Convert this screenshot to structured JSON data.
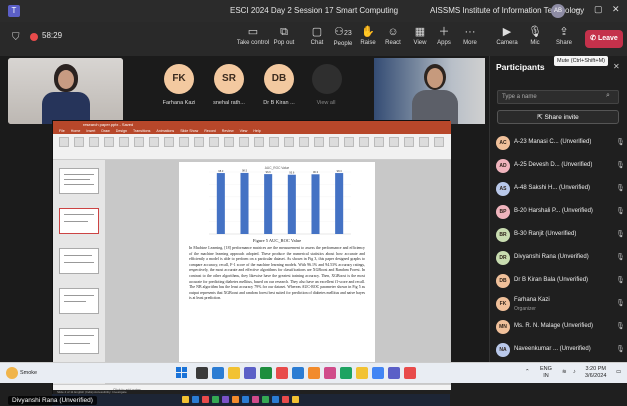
{
  "window": {
    "title": "ESCI 2024 Day 2 Session 17 Smart Computing",
    "org": "AISSMS Institute of Information Technology",
    "org_initials": "AB",
    "minimize": "–",
    "maximize": "▢",
    "close": "✕"
  },
  "toolbar": {
    "timer": "58:29",
    "take_control": "Take control",
    "pop_out": "Pop out",
    "chat": "Chat",
    "people": "People",
    "people_count": "23",
    "raise": "Raise",
    "react": "React",
    "view": "View",
    "apps": "Apps",
    "more": "More",
    "camera": "Camera",
    "mic": "Mic",
    "share": "Share",
    "leave": "Leave"
  },
  "stage": {
    "avatars": [
      {
        "initials": "FK",
        "name": "Farhana Kazi",
        "color": "#f3c9a0"
      },
      {
        "initials": "SR",
        "name": "snehal rath...",
        "color": "#f3c9a0"
      },
      {
        "initials": "DB",
        "name": "Dr B Kiran ...",
        "color": "#f3c9a0"
      }
    ],
    "more_label": "View all",
    "self_name": "Divyanshi Rana (Unverified)"
  },
  "ppt": {
    "file": "research paper.pptx - Saved",
    "menu": [
      "File",
      "Home",
      "Insert",
      "Draw",
      "Design",
      "Transitions",
      "Animations",
      "Slide Show",
      "Record",
      "Review",
      "View",
      "Help"
    ],
    "caption": "Figure 5 AUC_ROC Value",
    "status": "Slide 4 of 11   English (India)   Accessibility: Investigate",
    "notes": "Click to add notes",
    "paragraph": "In Machine Learning, [18] performance matrices are the measurement to assess the performance and efficiency of the machine learning approach adopted. These produce the numerical statistics about how accurate and efficiently a model is able to perform on a particular dataset. As shown in Fig 3, this paper designed graphs to compare accuracy, recall, F-1 score of the machine learning models. With 96.1% and 94.53% accuracy ratings, respectively, the most accurate and effective algorithms for classifications are XGBoost and Random Forest. In contrast to the other algorithms, they likewise have the greatest training accuracy. Then, XGBoost is the most accurate for predicting diabetes mellitus, based on our research. They also have an excellent f1-score and recall. The NB algorithm has the least accuracy 79% for our dataset. Whereas AUC-ROC parameter shown in Fig 5 as output represents that XGBoost and random forest best suited for prediction of diabetes mellitus and naive bayes is at least prediction."
  },
  "chart_data": {
    "type": "bar",
    "title": "AUC_ROC Value",
    "categories": [
      "",
      "",
      "",
      "",
      "",
      ""
    ],
    "values": [
      98.3,
      98.5,
      96.6,
      95.6,
      96.3,
      98.3
    ],
    "ylim": [
      0,
      100
    ],
    "bar_color": "#4472c4"
  },
  "panel": {
    "title": "Participants",
    "tooltip": "Mute (Ctrl+Shift+M)",
    "search_placeholder": "Type a name",
    "share_invite": "Share invite",
    "participants": [
      {
        "initials": "AC",
        "name": "A-23 Manasi C... (Unverified)",
        "sub": "",
        "color": "#f0c09a"
      },
      {
        "initials": "AD",
        "name": "A-25 Devesh D... (Unverified)",
        "sub": "",
        "color": "#f0b4bd"
      },
      {
        "initials": "AS",
        "name": "A-48 Sakshi H... (Unverified)",
        "sub": "",
        "color": "#b9c8ea"
      },
      {
        "initials": "BP",
        "name": "B-20 Harshali P... (Unverified)",
        "sub": "",
        "color": "#f0b4bd"
      },
      {
        "initials": "BR",
        "name": "B-30 Ranjit (Unverified)",
        "sub": "",
        "color": "#c8dcb0"
      },
      {
        "initials": "DR",
        "name": "Divyanshi Rana (Unverified)",
        "sub": "",
        "color": "#c8dcb0"
      },
      {
        "initials": "DB",
        "name": "Dr B Kiran Bala (Unverified)",
        "sub": "",
        "color": "#f0c09a"
      },
      {
        "initials": "FK",
        "name": "Farhana Kazi",
        "sub": "Organizer",
        "color": "#f0c09a"
      },
      {
        "initials": "MN",
        "name": "Ms. R. N. Malage (Unverified)",
        "sub": "",
        "color": "#f0c09a"
      },
      {
        "initials": "NA",
        "name": "Naveenkumar ... (Unverified)",
        "sub": "",
        "color": "#b9c8ea"
      }
    ]
  },
  "taskbar": {
    "weather": "Smoke",
    "lang_top": "ENG",
    "lang_bottom": "IN",
    "time": "3:20 PM",
    "date": "3/6/2024"
  }
}
